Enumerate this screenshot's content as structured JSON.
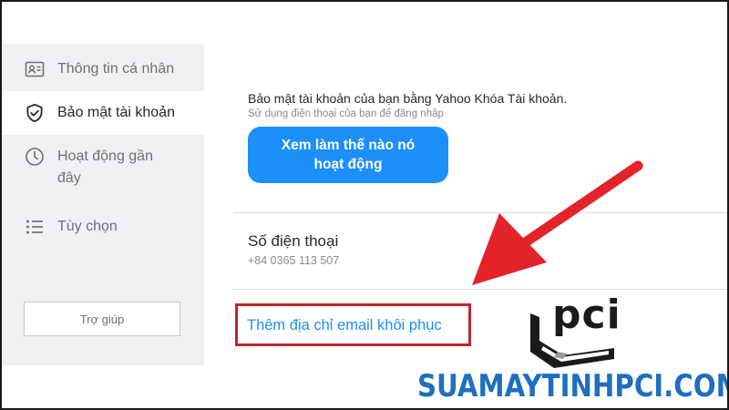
{
  "sidebar": {
    "items": [
      {
        "label": "Thông tin cá nhân",
        "icon": "id-card-icon",
        "active": false
      },
      {
        "label": "Bảo mật tài khoản",
        "icon": "shield-check-icon",
        "active": true
      },
      {
        "label": "Hoạt động gần đây",
        "icon": "clock-icon",
        "active": false
      },
      {
        "label": "Tùy chọn",
        "icon": "list-icon",
        "active": false
      }
    ],
    "help_label": "Trợ giúp"
  },
  "main": {
    "account_key": {
      "title": "Bảo mật tài khoản của bạn bằng Yahoo Khóa Tài khoản.",
      "subtitle": "Sử dụng điện thoại của bạn để đăng nhập",
      "button_label": "Xem làm thế nào nó hoạt động"
    },
    "phone": {
      "title": "Số điện thoại",
      "value": "+84 0365 113 507"
    },
    "add_email_label": "Thêm địa chỉ email khôi phục"
  },
  "overlay": {
    "logo_text": "pci",
    "watermark": "SUAMAYTINHPCI.COM",
    "arrow_color": "#e3232a",
    "highlight_color": "#c0242b",
    "accent": "#1c8ff8"
  }
}
